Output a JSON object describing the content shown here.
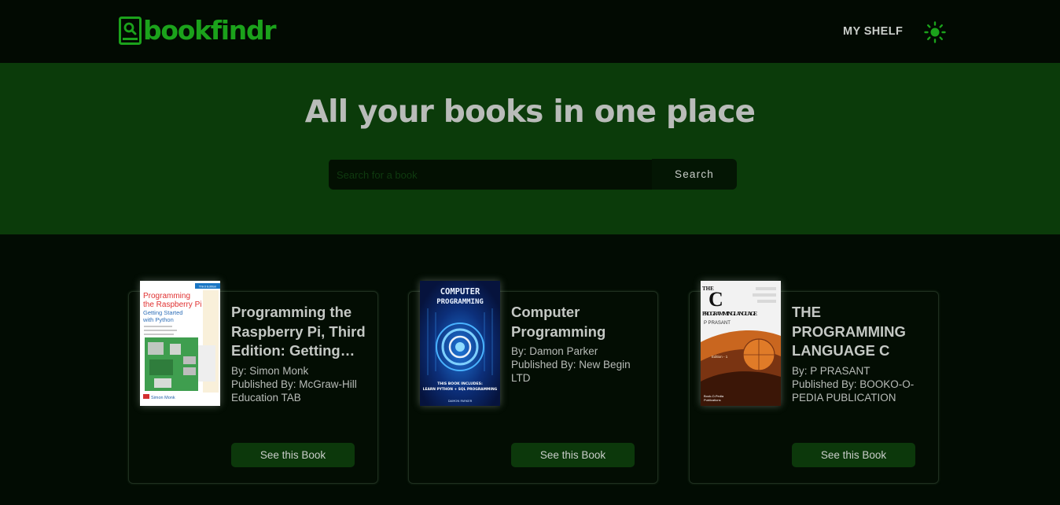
{
  "app": {
    "logo_text": "bookfindr",
    "brand_color": "#1ba21b",
    "nav_shelf_label": "MY SHELF",
    "theme_icon": "sun-icon"
  },
  "hero": {
    "title": "All your books in one place",
    "search_placeholder": "Search for a book",
    "search_value": "",
    "search_button": "Search"
  },
  "books": [
    {
      "title": "Programming the Raspberry Pi, Third Edition: Getting…",
      "author": "By: Simon Monk",
      "publisher": "Published By: McGraw-Hill Education TAB",
      "button": "See this Book",
      "cover": {
        "edition_badge": "Third Edition",
        "title_lines": [
          "Programming",
          "the Raspberry Pi"
        ],
        "subtitle_lines": [
          "Getting Started",
          "with Python"
        ],
        "author": "Simon Monk"
      }
    },
    {
      "title": "Computer Programming",
      "author": "By: Damon Parker",
      "publisher": "Published By: New Begin LTD",
      "button": "See this Book",
      "cover": {
        "title_lines": [
          "COMPUTER",
          "PROGRAMMING"
        ],
        "includes_lines": [
          "THIS BOOK INCLUDES:",
          "LEARN PYTHON + SQL PROGRAMMING"
        ],
        "author": "DAMON PARKER"
      }
    },
    {
      "title": "THE PROGRAMMING LANGUAGE C",
      "author": "By: P PRASANT",
      "publisher": "Published By: BOOKO-O-PEDIA PUBLICATION",
      "button": "See this Book",
      "cover": {
        "the": "THE",
        "letter": "C",
        "title": "PROGRAMMING LANGUAGE",
        "author": "P PRASANT",
        "edition": "Edition - 1",
        "publisher_lines": [
          "Book-O-Pedia",
          "Publications"
        ]
      }
    }
  ]
}
